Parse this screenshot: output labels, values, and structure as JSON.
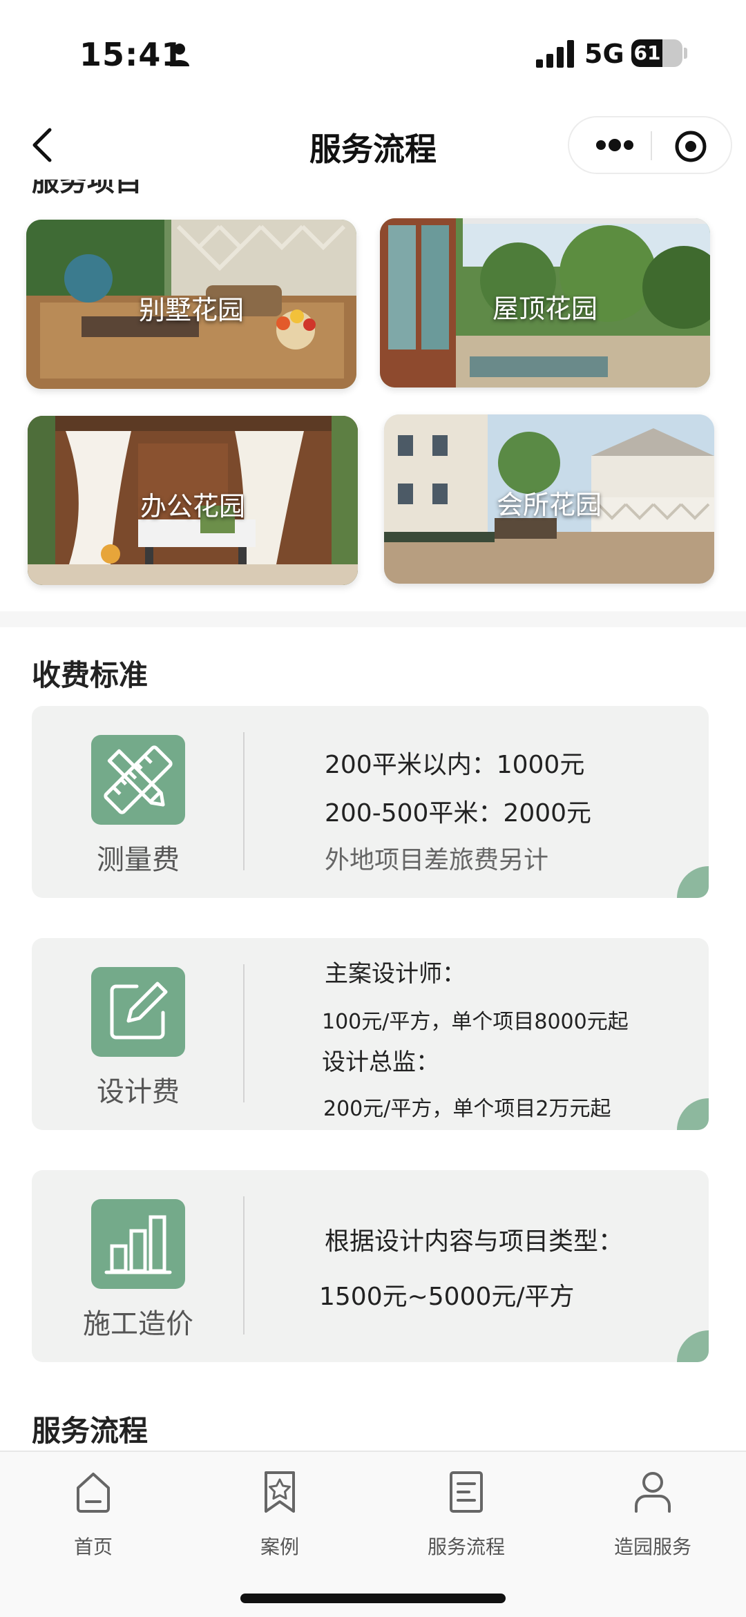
{
  "status_bar": {
    "time": "15:41",
    "network": "5G",
    "battery": "61",
    "battery_level": 0.61
  },
  "nav": {
    "title": "服务流程"
  },
  "service_items": {
    "heading_clipped": "服务项目",
    "tiles": [
      {
        "label": "别墅花园"
      },
      {
        "label": "屋顶花园"
      },
      {
        "label": "办公花园"
      },
      {
        "label": "会所花园"
      }
    ]
  },
  "fees": {
    "title": "收费标准",
    "cards": [
      {
        "name": "测量费",
        "icon": "ruler-pencil-icon",
        "lines": [
          "200平米以内：1000元",
          "200-500平米：2000元",
          "外地项目差旅费另计"
        ]
      },
      {
        "name": "设计费",
        "icon": "edit-icon",
        "lines": [
          "主案设计师：",
          "100元/平方，单个项目8000元起",
          "设计总监：",
          "200元/平方，单个项目2万元起"
        ]
      },
      {
        "name": "施工造价",
        "icon": "bar-chart-icon",
        "lines": [
          "根据设计内容与项目类型：",
          "1500元~5000元/平方"
        ]
      }
    ]
  },
  "process": {
    "title": "服务流程"
  },
  "tabbar": {
    "items": [
      {
        "label": "首页",
        "icon": "home-icon"
      },
      {
        "label": "案例",
        "icon": "bookmark-star-icon"
      },
      {
        "label": "服务流程",
        "icon": "document-icon"
      },
      {
        "label": "造园服务",
        "icon": "user-icon"
      }
    ]
  },
  "colors": {
    "accent_green": "#74aa8a",
    "card_bg": "#f1f2f1"
  }
}
